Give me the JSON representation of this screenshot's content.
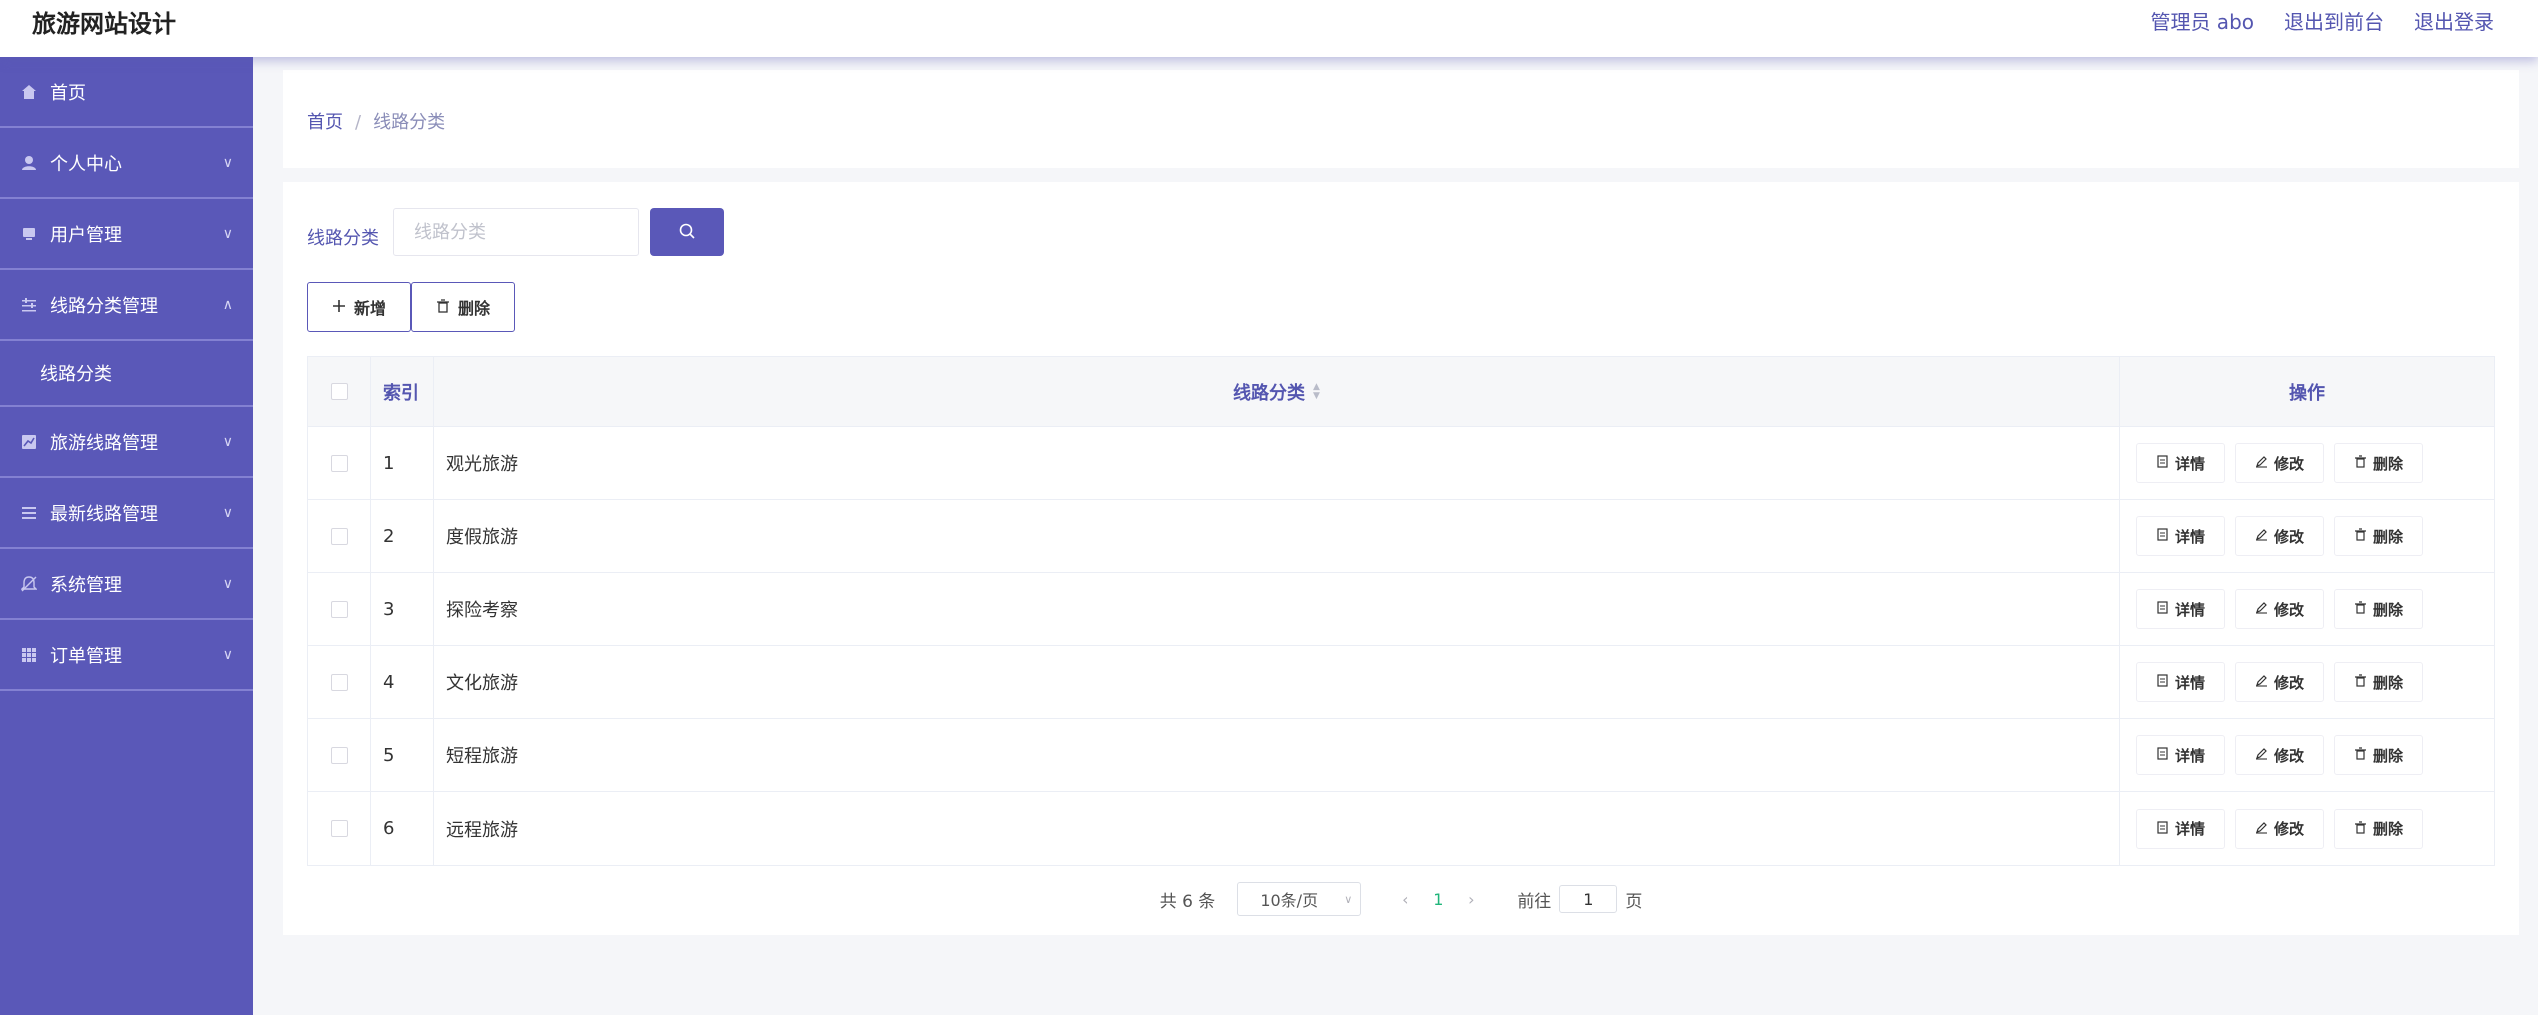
{
  "header": {
    "brand": "旅游网站设计",
    "admin_label": "管理员 abo",
    "front_label": "退出到前台",
    "logout_label": "退出登录"
  },
  "sidebar": {
    "items": [
      {
        "label": "首页",
        "icon": "home-icon"
      },
      {
        "label": "个人中心",
        "icon": "user-icon"
      },
      {
        "label": "用户管理",
        "icon": "users-icon"
      },
      {
        "label": "线路分类管理",
        "icon": "sliders-icon",
        "expanded": true
      },
      {
        "label": "旅游线路管理",
        "icon": "chart-icon"
      },
      {
        "label": "最新线路管理",
        "icon": "list-icon"
      },
      {
        "label": "系统管理",
        "icon": "bell-icon"
      },
      {
        "label": "订单管理",
        "icon": "grid-icon"
      }
    ],
    "submenu_label": "线路分类"
  },
  "breadcrumb": {
    "home": "首页",
    "sep": "/",
    "current": "线路分类"
  },
  "search": {
    "label": "线路分类",
    "placeholder": "线路分类"
  },
  "actions": {
    "add": "新增",
    "delete": "删除"
  },
  "table": {
    "headers": {
      "index": "索引",
      "name": "线路分类",
      "ops": "操作"
    },
    "rows": [
      {
        "index": "1",
        "name": "观光旅游"
      },
      {
        "index": "2",
        "name": "度假旅游"
      },
      {
        "index": "3",
        "name": "探险考察"
      },
      {
        "index": "4",
        "name": "文化旅游"
      },
      {
        "index": "5",
        "name": "短程旅游"
      },
      {
        "index": "6",
        "name": "远程旅游"
      }
    ],
    "row_ops": {
      "detail": "详情",
      "edit": "修改",
      "delete": "删除"
    }
  },
  "pagination": {
    "total": "共 6 条",
    "page_size": "10条/页",
    "current_page": "1",
    "goto_prefix": "前往",
    "goto_value": "1",
    "goto_suffix": "页"
  },
  "colors": {
    "primary": "#5a58b8",
    "accent_link": "#5456b0",
    "active_page": "#20b57a"
  }
}
